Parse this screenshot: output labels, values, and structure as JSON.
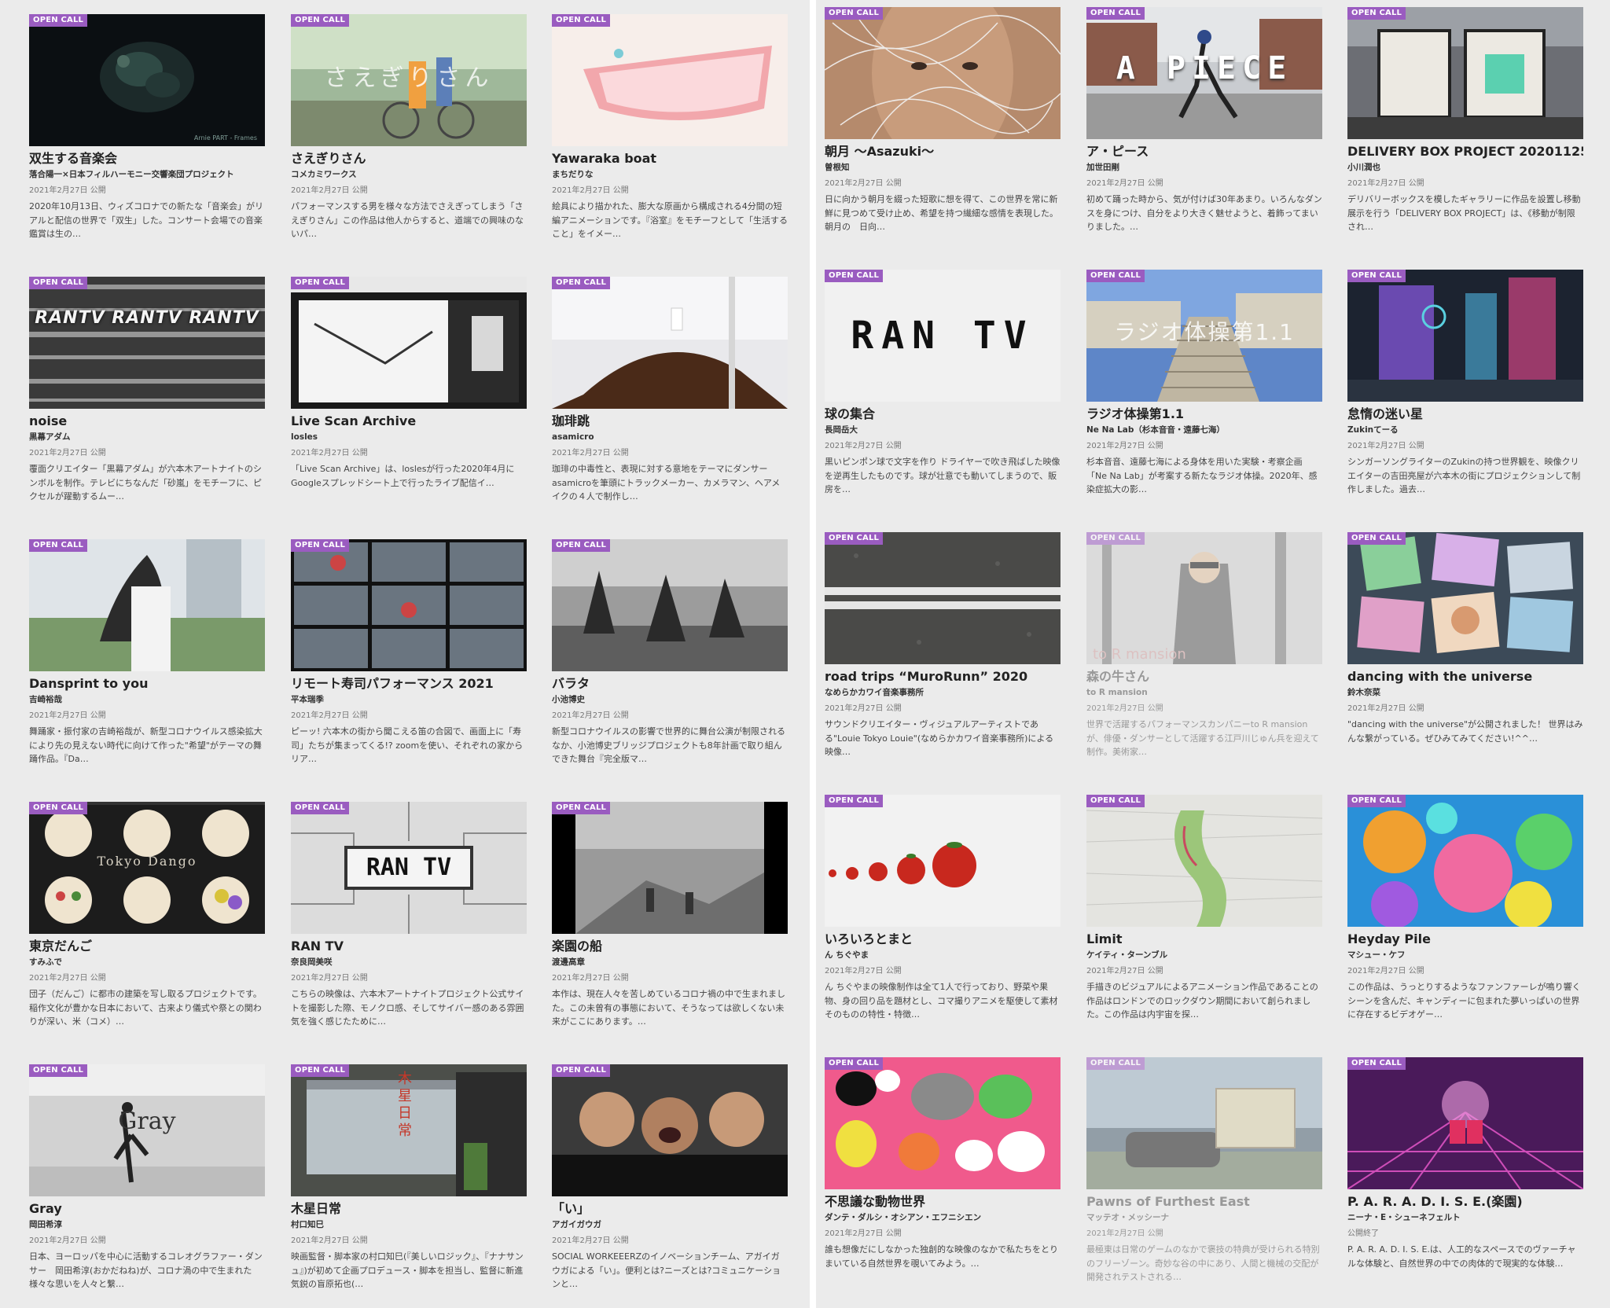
{
  "badge_label": "OPEN CALL",
  "colors": {
    "badge": "#9a5cc0",
    "background": "#ebebeb"
  },
  "left_grid": [
    {
      "title": "双生する音楽会",
      "artist": "落合陽一×日本フィルハーモニー交響楽団プロジェクト",
      "date": "2021年2月27日 公開",
      "desc": "2020年10月13日、ウィズコロナでの新たな「音楽会」がリアルと配信の世界で「双生」した。コンサート会場での音楽鑑賞は生の…",
      "thumb_overlay": "Arnie PART - Frames"
    },
    {
      "title": "さえぎりさん",
      "artist": "コメカミワークス",
      "date": "2021年2月27日 公開",
      "desc": "パフォーマンスする男を様々な方法でさえぎってしまう「さえぎりさん」この作品は他人からすると、道端での興味のないパ…",
      "thumb_overlay": "さえぎりさん"
    },
    {
      "title": "Yawaraka boat",
      "artist": "まちだりな",
      "date": "2021年2月27日 公開",
      "desc": "絵具により描かれた、膨大な原画から構成される4分間の短編アニメーションです。『浴室』をモチーフとして「生活すること」をイメー…",
      "thumb_overlay": ""
    },
    {
      "title": "noise",
      "artist": "黒幕アダム",
      "date": "2021年2月27日 公開",
      "desc": "覆面クリエイター「黒幕アダム」が六本木アートナイトのシンボルを制作。テレビにちなんだ「砂嵐」をモチーフに、ピクセルが躍動するムー…",
      "thumb_overlay": "RANTV RANTV RANTV"
    },
    {
      "title": "Live Scan Archive",
      "artist": "losles",
      "date": "2021年2月27日 公開",
      "desc": "「Live Scan Archive」は、loslesが行った2020年4月にGoogleスプレッドシート上で行ったライブ配信イ…",
      "thumb_overlay": ""
    },
    {
      "title": "珈琲跳",
      "artist": "asamicro",
      "date": "2021年2月27日 公開",
      "desc": "珈琲の中毒性と、表現に対する意地をテーマにダンサーasamicroを筆頭にトラックメーカー、カメラマン、ヘアメイクの４人で制作し…",
      "thumb_overlay": ""
    },
    {
      "title": "Dansprint to you",
      "artist": "吉崎裕哉",
      "date": "2021年2月27日 公開",
      "desc": "舞踊家・振付家の吉崎裕哉が、新型コロナウイルス感染拡大により先の見えない時代に向けて作った\"希望\"がテーマの舞踊作品。『Da…",
      "thumb_overlay": ""
    },
    {
      "title": "リモート寿司パフォーマンス 2021",
      "artist": "平本瑞季",
      "date": "2021年2月27日 公開",
      "desc": "ピーッ! 六本木の街から聞こえる笛の合図で、画面上に「寿司」たちが集まってくる!? zoomを使い、それぞれの家からリア…",
      "thumb_overlay": ""
    },
    {
      "title": "バラタ",
      "artist": "小池博史",
      "date": "2021年2月27日 公開",
      "desc": "新型コロナウイルスの影響で世界的に舞台公演が制限されるなか、小池博史ブリッジプロジェクトも8年計画で取り組んできた舞台『完全版マ…",
      "thumb_overlay": ""
    },
    {
      "title": "東京だんご",
      "artist": "すみふで",
      "date": "2021年2月27日 公開",
      "desc": "団子（だんご）に都市の建築を写し取るプロジェクトです。稲作文化が豊かな日本において、古来より儀式や祭との関わりが深い、米（コメ）…",
      "thumb_overlay": "Tokyo Dango"
    },
    {
      "title": "RAN TV",
      "artist": "奈良岡美咲",
      "date": "2021年2月27日 公開",
      "desc": "こちらの映像は、六本木アートナイトプロジェクト公式サイトを撮影した際、モノクロ感、そしてサイバー感のある雰囲気を強く感じたために…",
      "thumb_overlay": "RAN TV"
    },
    {
      "title": "楽園の船",
      "artist": "渡邊高章",
      "date": "2021年2月27日 公開",
      "desc": "本作は、現在人々を苦しめているコロナ禍の中で生まれました。この未曾有の事態において、そうなっては欲しくない未来がここにあります。…",
      "thumb_overlay": ""
    },
    {
      "title": "Gray",
      "artist": "岡田希淳",
      "date": "2021年2月27日 公開",
      "desc": "日本、ヨーロッパを中心に活動するコレオグラファー・ダンサー　岡田希淳(おかだねね)が、コロナ渦の中で生まれた様々な思いを人々と繋…",
      "thumb_overlay": "Gray"
    },
    {
      "title": "木星日常",
      "artist": "村口知巳",
      "date": "2021年2月27日 公開",
      "desc": "映画監督・脚本家の村口知巳(『美しいロジック』、『ナナサンュ』)が初めて企画プロデュース・脚本を担当し、監督に新進気鋭の盲原拓也(…",
      "thumb_overlay": "木星日常"
    },
    {
      "title": "「い」",
      "artist": "アガイガウガ",
      "date": "2021年2月27日 公開",
      "desc": "SOCIAL WORKEEERZのイノベーションチーム、アガイガウガによる「い」。便利とは?ニーズとは?コミュニケーションと…",
      "thumb_overlay": ""
    }
  ],
  "right_grid": [
    {
      "title": "朝月 〜Asazuki〜",
      "artist": "曽根知",
      "date": "2021年2月27日 公開",
      "desc": "日に向かう朝月を綴った短歌に想を得て、この世界を常に新鮮に見つめて受け止め、希望を持つ繊細な感情を表現した。朝月の　日向…",
      "thumb_overlay": ""
    },
    {
      "title": "ア・ピース",
      "artist": "加世田剛",
      "date": "2021年2月27日 公開",
      "desc": "初めて踊った時から、気が付けば30年あまり。いろんなダンスを身につけ、自分をより大きく魅せようと、着飾ってまいりました。…",
      "thumb_overlay": "A PIECE"
    },
    {
      "title": "DELIVERY BOX PROJECT 20201125",
      "artist": "小川潤也",
      "date": "2021年2月27日 公開",
      "desc": "デリバリーボックスを模したギャラリーに作品を設置し移動展示を行う「DELIVERY BOX PROJECT」は、《移動が制限され…",
      "thumb_overlay": ""
    },
    {
      "title": "球の集合",
      "artist": "長岡岳大",
      "date": "2021年2月27日 公開",
      "desc": "黒いピンポン球で文字を作り ドライヤーで吹き飛ばした映像を逆再生したものです。球が壮意でも動いてしまうので、販房を…",
      "thumb_overlay": "RAN TV"
    },
    {
      "title": "ラジオ体操第1.1",
      "artist": "Ne Na Lab（杉本音音・遠藤七海）",
      "date": "2021年2月27日 公開",
      "desc": "杉本音音、遠藤七海による身体を用いた実験・考察企画「Ne Na Lab」が考案する新たなラジオ体操。2020年、感染症拡大の影…",
      "thumb_overlay": "ラジオ体操第1.1"
    },
    {
      "title": "怠惰の迷い星",
      "artist": "Zukinてーる",
      "date": "2021年2月27日 公開",
      "desc": "シンガーソングライターのZukinの持つ世界観を、映像クリエイターの吉田亮屋が六本木の街にプロジェクションして制作しました。過去…",
      "thumb_overlay": ""
    },
    {
      "title": "road trips “MuroRunn” 2020",
      "artist": "なめらかカワイ音楽事務所",
      "date": "2021年2月27日 公開",
      "desc": "サウンドクリエイター・ヴィジュアルアーティストである\"Louie Tokyo Louie\"(なめらかカワイ音楽事務所)による映像…",
      "thumb_overlay": ""
    },
    {
      "title": "森の牛さん",
      "artist": "to R mansion",
      "date": "2021年2月27日 公開",
      "desc": "世界で活躍するパフォーマンスカンパニーto R mansionが、俳優・ダンサーとして活躍する江戸川じゅん兵を迎えて制作。美術家…",
      "thumb_overlay": "to R mansion"
    },
    {
      "title": "dancing with the universe",
      "artist": "鈴木奈菜",
      "date": "2021年2月27日 公開",
      "desc": "\"dancing with the universe\"が公開されました！ 世界はみんな繋がっている。ぜひみてみてください!^^…",
      "thumb_overlay": ""
    },
    {
      "title": "いろいろとまと",
      "artist": "ん ちぐやま",
      "date": "2021年2月27日 公開",
      "desc": "ん ちぐやまの映像制作は全て1人で行っており、野菜や果物、身の回り品を題材とし、コマ撮りアニメを駆使して素材そのものの特性・特徴…",
      "thumb_overlay": ""
    },
    {
      "title": "Limit",
      "artist": "ケイティ・ターンブル",
      "date": "2021年2月27日 公開",
      "desc": "手描きのビジュアルによるアニメーション作品であることの作品はロンドンでのロックダウン期間において創られました。この作品は内宇宙を探…",
      "thumb_overlay": ""
    },
    {
      "title": "Heyday Pile",
      "artist": "マシュー・ケフ",
      "date": "2021年2月27日 公開",
      "desc": "この作品は、うっとりするようなファンファーレが鳴り響くシーンを含んだ、キャンディーに包まれた夢いっぱいの世界に存在するビデオゲー…",
      "thumb_overlay": ""
    },
    {
      "title": "不思議な動物世界",
      "artist": "ダンテ・ダルシ・オシアン・エフニシエン",
      "date": "2021年2月27日 公開",
      "desc": "誰も想像だにしなかった独創的な映像のなかで私たちをとりまいている自然世界を覗いてみよう。…",
      "thumb_overlay": ""
    },
    {
      "title": "Pawns of Furthest East",
      "artist": "マッテオ・メッシーナ",
      "date": "2021年2月27日 公開",
      "desc": "最極東は日常のゲームのなかで褒技の特典が受けられる特別のフリーゾーン。奇妙な谷の中にあり、人間と機械の交配が開発されテストされる…",
      "thumb_overlay": ""
    },
    {
      "title": "P. A. R. A. D. I. S. E.(楽園)",
      "artist": "ニーナ・E・シューネフェルト",
      "date": "公開終了",
      "desc": "P. A. R. A. D. I. S. E.は、人工的なスペースでのヴァーチャルな体験と、自然世界の中での肉体的で現実的な体験…",
      "thumb_overlay": ""
    }
  ]
}
